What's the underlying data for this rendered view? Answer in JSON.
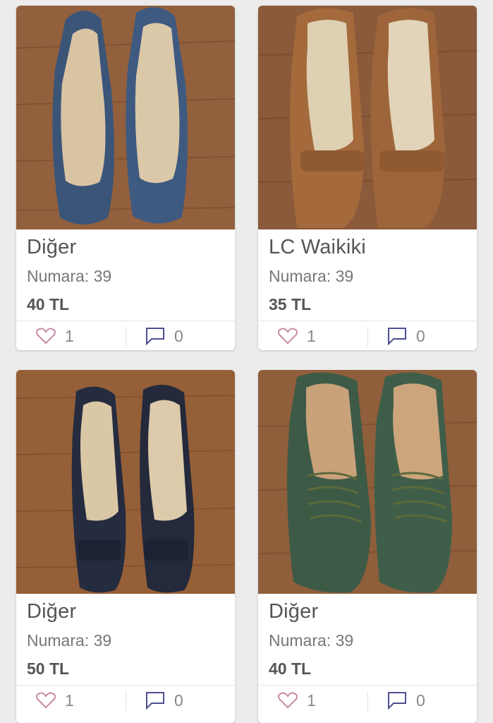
{
  "products": [
    {
      "brand": "Diğer",
      "size": "Numara: 39",
      "price": "40 TL",
      "likes": "1",
      "comments": "0",
      "image": "blue-denim-peep-toe-heels"
    },
    {
      "brand": "LC Waikiki",
      "size": "Numara: 39",
      "price": "35 TL",
      "likes": "1",
      "comments": "0",
      "image": "brown-leather-loafer-heels"
    },
    {
      "brand": "Diğer",
      "size": "Numara: 39",
      "price": "50 TL",
      "likes": "1",
      "comments": "0",
      "image": "navy-bow-pumps"
    },
    {
      "brand": "Diğer",
      "size": "Numara: 39",
      "price": "40 TL",
      "likes": "1",
      "comments": "0",
      "image": "green-suede-lace-up-heels"
    }
  ],
  "colors": {
    "heart": "#c98aa8",
    "comment": "#4d4f8f",
    "wood": "#8e5a37"
  },
  "icons": {
    "like": "heart-outline-icon",
    "comment": "speech-bubble-icon"
  }
}
